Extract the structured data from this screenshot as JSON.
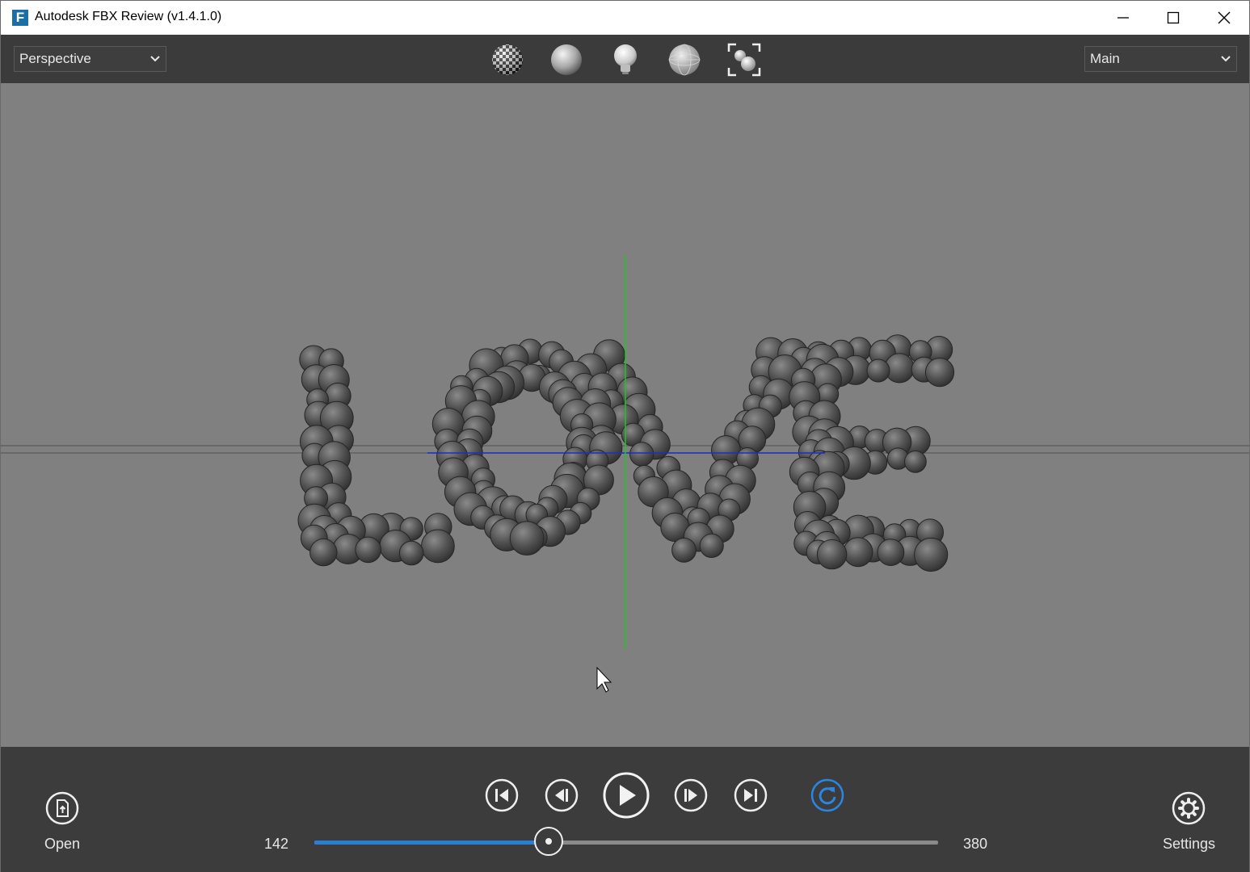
{
  "window": {
    "title": "Autodesk FBX Review (v1.4.1.0)",
    "logo_letter": "F",
    "controls": [
      "minimize-icon",
      "maximize-icon",
      "close-icon"
    ]
  },
  "toolbar": {
    "camera_dropdown": {
      "selected": "Perspective"
    },
    "take_dropdown": {
      "selected": "Main"
    },
    "tools": [
      {
        "name": "texture-toggle",
        "icon": "checker-sphere-icon"
      },
      {
        "name": "shading-toggle",
        "icon": "shaded-sphere-icon"
      },
      {
        "name": "lighting-toggle",
        "icon": "light-bulb-icon"
      },
      {
        "name": "wireframe-toggle",
        "icon": "wireframe-sphere-icon"
      },
      {
        "name": "frame-all",
        "icon": "frame-objects-icon"
      }
    ]
  },
  "viewport": {
    "background": "#808080",
    "axis_y_color": "#22c422",
    "axis_x_color": "#1a2ecc",
    "scene_text": "LOVE"
  },
  "playback": {
    "open_label": "Open",
    "settings_label": "Settings",
    "start_frame": "142",
    "end_frame": "380",
    "progress": 0.375,
    "loop_color": "#2a86e0",
    "controls": [
      "go-to-start-icon",
      "step-back-icon",
      "play-icon",
      "step-forward-icon",
      "go-to-end-icon",
      "loop-icon"
    ]
  },
  "colors": {
    "titlebar": "#ffffff",
    "toolbar": "#3b3b3b",
    "bottom_panel": "#3c3c3c",
    "accent": "#2a7fd4"
  }
}
